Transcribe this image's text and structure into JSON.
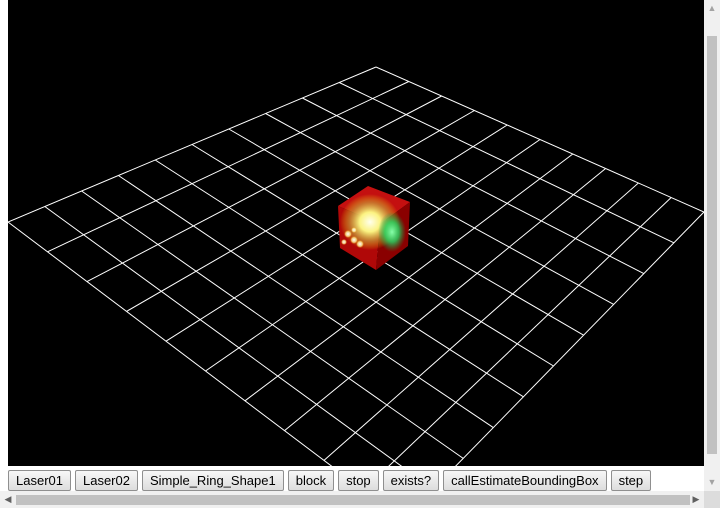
{
  "viewport": {
    "background": "#000000",
    "grid_color": "#ffffff",
    "grid_divisions": 10,
    "cube_colors": {
      "face": "#c00000",
      "glow": "#ffff99",
      "green_light": "#33ff66"
    }
  },
  "toolbar": {
    "buttons": [
      {
        "id": "laser01",
        "label": "Laser01"
      },
      {
        "id": "laser02",
        "label": "Laser02"
      },
      {
        "id": "ring",
        "label": "Simple_Ring_Shape1"
      },
      {
        "id": "block",
        "label": "block"
      },
      {
        "id": "stop",
        "label": "stop"
      },
      {
        "id": "exists",
        "label": "exists?"
      },
      {
        "id": "bbox",
        "label": "callEstimateBoundingBox"
      },
      {
        "id": "step",
        "label": "step"
      }
    ]
  },
  "scrollbars": {
    "vertical_icons": [
      "scroll-up-arrow-icon",
      "scroll-down-arrow-icon"
    ],
    "horizontal_icons": [
      "scroll-left-arrow-icon",
      "scroll-right-arrow-icon"
    ]
  }
}
